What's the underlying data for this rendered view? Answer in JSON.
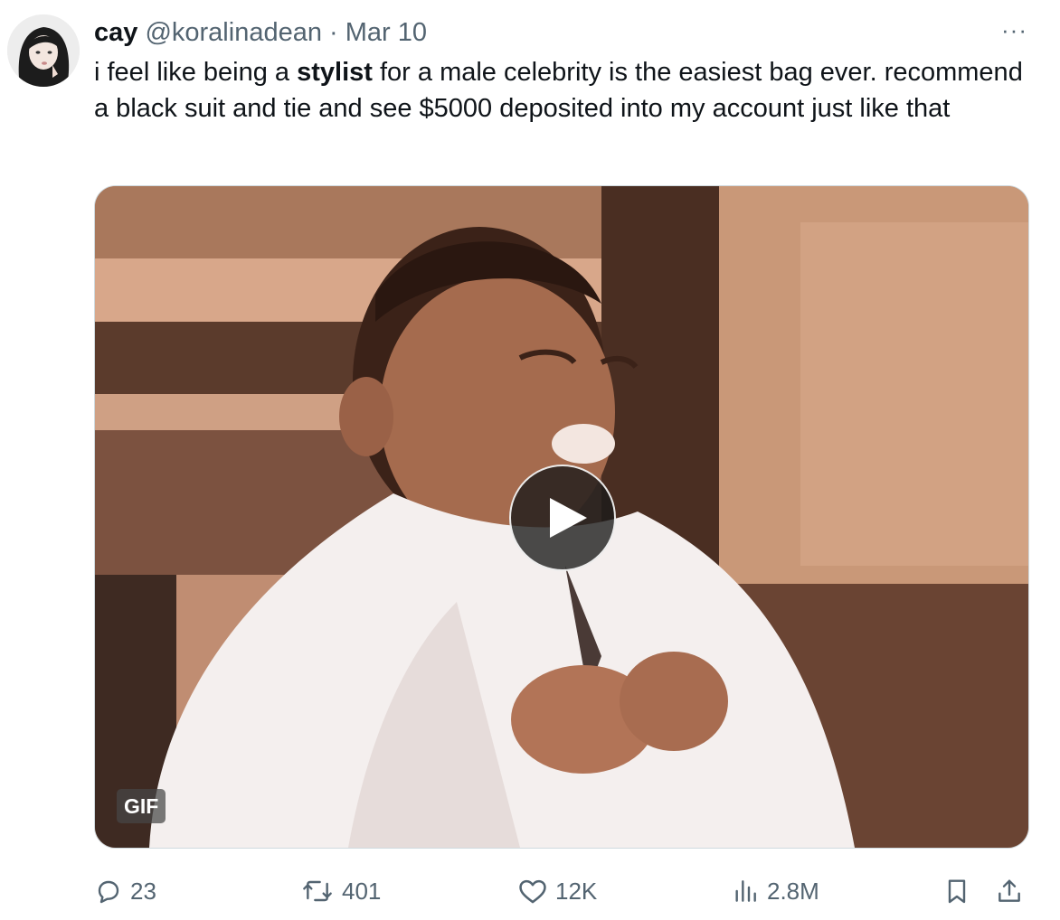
{
  "tweet": {
    "display_name": "cay",
    "handle": "@koralinadean",
    "separator": "·",
    "date": "Mar 10",
    "more_label": "···",
    "text_before": "i feel like being a ",
    "text_bold": "stylist",
    "text_after": " for a male celebrity is the easiest bag ever. recommend a black suit and tie and see $5000 deposited into my account just like that"
  },
  "media": {
    "type": "gif",
    "badge": "GIF",
    "play_icon": "play-icon"
  },
  "actions": {
    "replies": "23",
    "retweets": "401",
    "likes": "12K",
    "views": "2.8M"
  },
  "colors": {
    "text": "#0f1419",
    "muted": "#536471",
    "border": "#cfd9de"
  }
}
